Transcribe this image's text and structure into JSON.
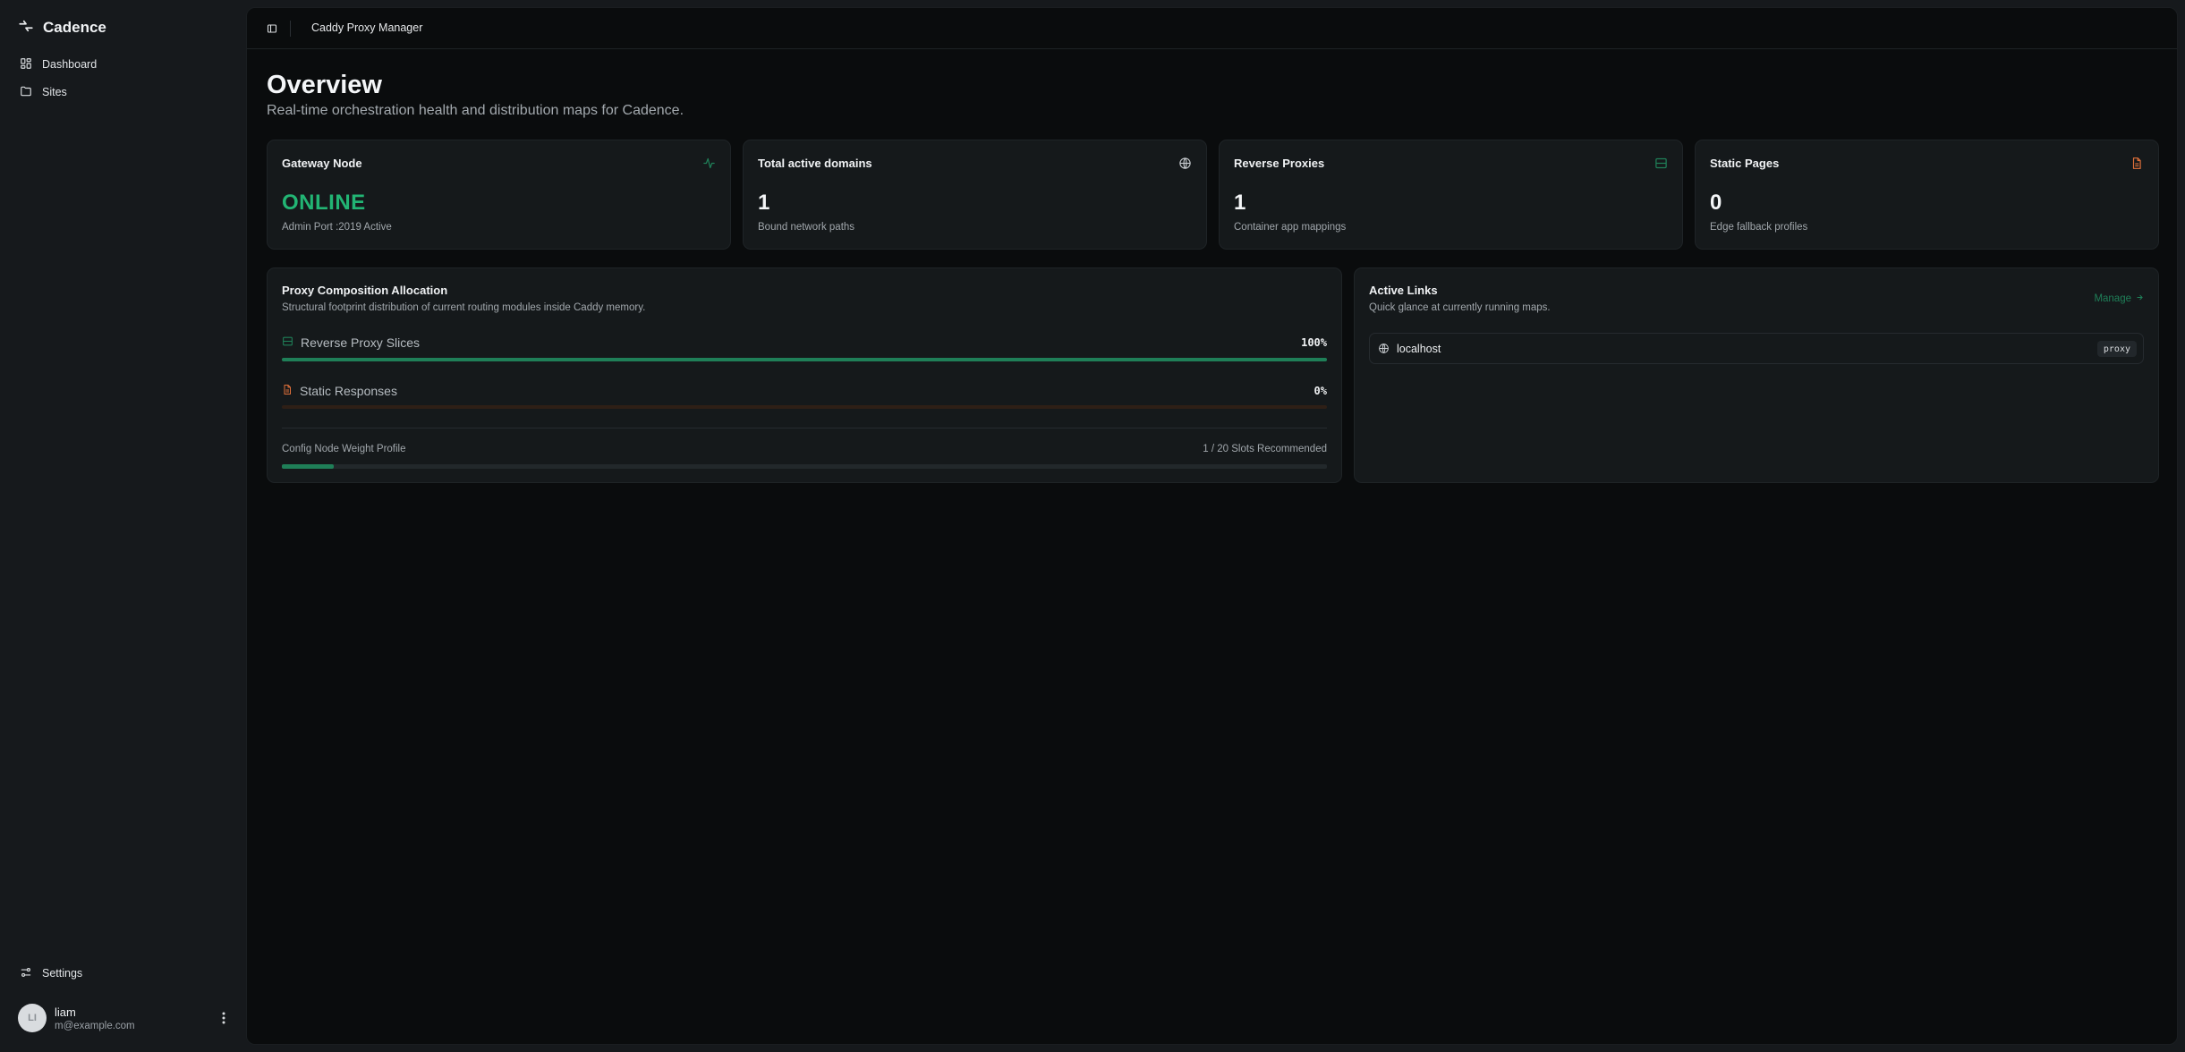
{
  "brand": {
    "name": "Cadence",
    "icon": "cadence-logo-icon"
  },
  "sidebar": {
    "items": [
      {
        "label": "Dashboard",
        "icon": "dashboard-grid-icon"
      },
      {
        "label": "Sites",
        "icon": "folder-icon"
      }
    ],
    "footer_items": [
      {
        "label": "Settings",
        "icon": "sliders-icon"
      }
    ],
    "user": {
      "initials": "LI",
      "name": "liam",
      "email": "m@example.com"
    }
  },
  "topbar": {
    "breadcrumb": "Caddy Proxy Manager",
    "toggle_icon": "sidebar-toggle-icon"
  },
  "header": {
    "title": "Overview",
    "subtitle": "Real-time orchestration health and distribution maps for Cadence."
  },
  "colors": {
    "accent": "#22b574",
    "orange": "#e0703a",
    "muted": "#a1a7ac"
  },
  "stats": [
    {
      "title": "Gateway Node",
      "value": "ONLINE",
      "desc": "Admin Port :2019 Active",
      "icon": "activity-icon"
    },
    {
      "title": "Total active domains",
      "value": "1",
      "desc": "Bound network paths",
      "icon": "globe-icon"
    },
    {
      "title": "Reverse Proxies",
      "value": "1",
      "desc": "Container app mappings",
      "icon": "server-icon"
    },
    {
      "title": "Static Pages",
      "value": "0",
      "desc": "Edge fallback profiles",
      "icon": "file-icon"
    }
  ],
  "allocation": {
    "title": "Proxy Composition Allocation",
    "subtitle": "Structural footprint distribution of current routing modules inside Caddy memory.",
    "rows": [
      {
        "label": "Reverse Proxy Slices",
        "percent_label": "100%",
        "percent": 100,
        "color": "#1f7f58",
        "icon": "server-icon"
      },
      {
        "label": "Static Responses",
        "percent_label": "0%",
        "percent": 0,
        "color": "#e0703a",
        "icon": "file-icon"
      }
    ],
    "weight": {
      "label": "Config Node Weight Profile",
      "value": "1 / 20 Slots Recommended",
      "fraction": 0.05
    }
  },
  "links": {
    "title": "Active Links",
    "subtitle": "Quick glance at currently running maps.",
    "manage_label": "Manage",
    "items": [
      {
        "name": "localhost",
        "tag": "proxy",
        "icon": "globe-icon"
      }
    ]
  }
}
